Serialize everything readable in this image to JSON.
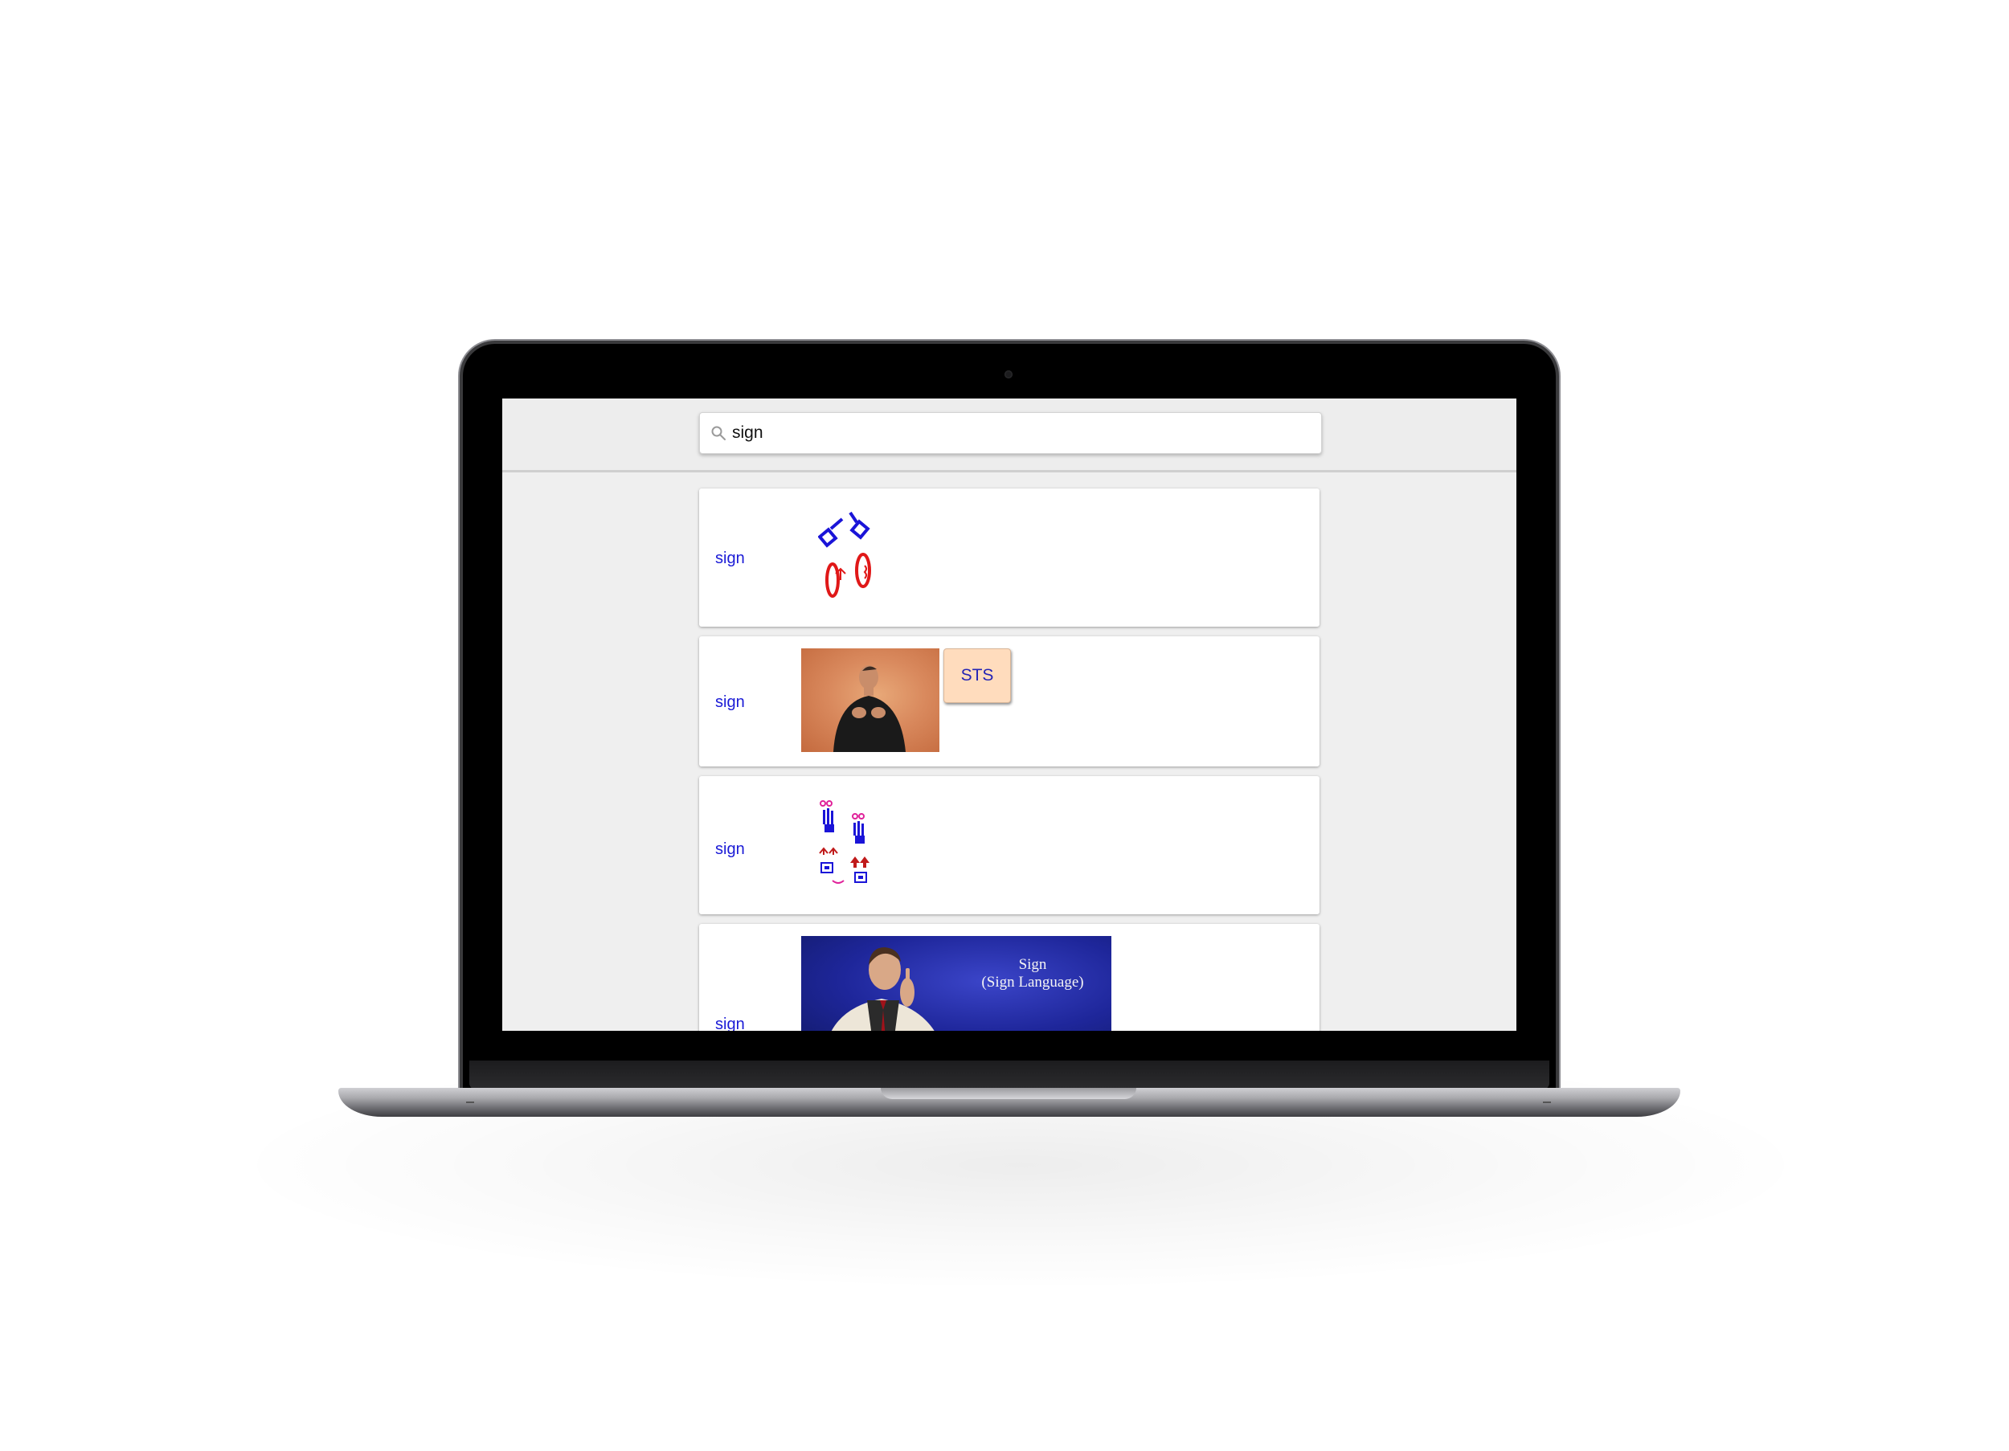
{
  "search": {
    "value": "sign",
    "icon": "search-icon"
  },
  "results": [
    {
      "word": "sign",
      "kind": "signwriting"
    },
    {
      "word": "sign",
      "kind": "video",
      "button_label": "STS"
    },
    {
      "word": "sign",
      "kind": "signwriting"
    },
    {
      "word": "sign",
      "kind": "video",
      "video_title": "Sign",
      "video_subtitle": "(Sign Language)"
    }
  ],
  "colors": {
    "link": "#1a1ad6",
    "sts_button_bg": "#ffdcbd",
    "page_bg": "#efefef"
  }
}
